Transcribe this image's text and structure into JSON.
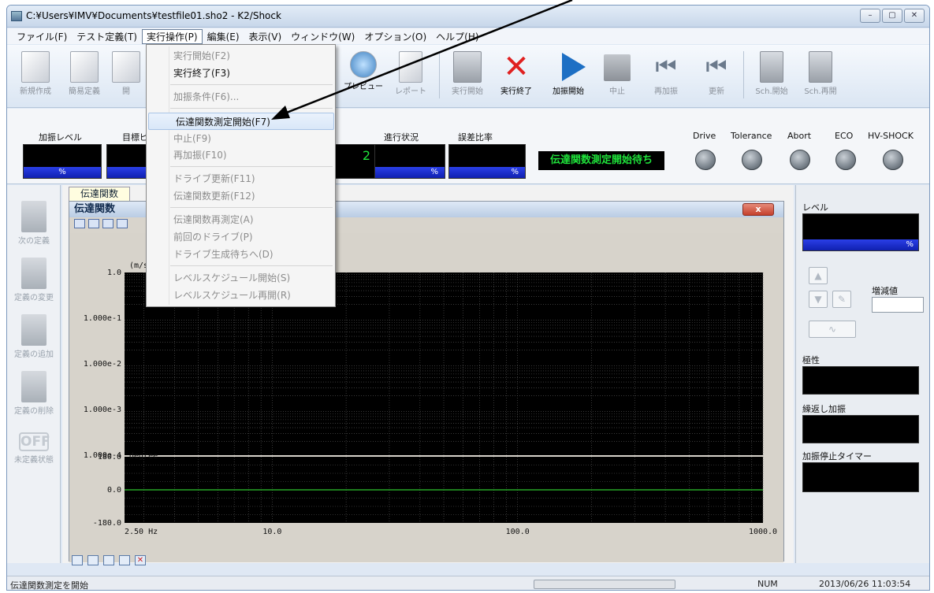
{
  "window": {
    "title": "C:¥Users¥IMV¥Documents¥testfile01.sho2 - K2/Shock",
    "min_label": "–",
    "max_label": "▢",
    "close_label": "✕"
  },
  "menu": [
    {
      "label": "ファイル(F)"
    },
    {
      "label": "テスト定義(T)"
    },
    {
      "label": "実行操作(P)"
    },
    {
      "label": "編集(E)"
    },
    {
      "label": "表示(V)"
    },
    {
      "label": "ウィンドウ(W)"
    },
    {
      "label": "オプション(O)"
    },
    {
      "label": "ヘルプ(H)"
    }
  ],
  "toolbar": [
    {
      "label": "新規作成",
      "enabled": false
    },
    {
      "label": "簡易定義",
      "enabled": false
    },
    {
      "label": "開",
      "enabled": false
    },
    {
      "label": "プレビュー",
      "enabled": true
    },
    {
      "label": "レポート",
      "enabled": false
    },
    {
      "label": "実行開始",
      "enabled": false
    },
    {
      "label": "実行終了",
      "enabled": true
    },
    {
      "label": "加振開始",
      "enabled": true
    },
    {
      "label": "中止",
      "enabled": false
    },
    {
      "label": "再加振",
      "enabled": false
    },
    {
      "label": "更新",
      "enabled": false
    },
    {
      "label": "Sch.開始",
      "enabled": false
    },
    {
      "label": "Sch.再開",
      "enabled": false
    }
  ],
  "monitor": {
    "level_label": "加振レベル",
    "level_unit": "%",
    "target_label": "目標ピ",
    "count_value": "2",
    "progress_label": "進行状況",
    "progress_unit": "%",
    "error_label": "誤差比率",
    "error_unit": "%",
    "status_message": "伝達関数測定開始待ち",
    "lamps": [
      "Drive",
      "Tolerance",
      "Abort",
      "ECO",
      "HV-SHOCK"
    ]
  },
  "left_sidebar": [
    {
      "label": "次の定義"
    },
    {
      "label": "定義の変更"
    },
    {
      "label": "定義の追加"
    },
    {
      "label": "定義の削除"
    },
    {
      "label": "未定義状態",
      "icon_text": "OFF"
    }
  ],
  "document": {
    "tab_label": "伝達関数",
    "child_title": "伝達関数",
    "child_close": "x"
  },
  "plot": {
    "magnitude_unit": "(m/s²)/",
    "y_ticks": [
      "1.0",
      "1.000e-1",
      "1.000e-2",
      "1.000e-3",
      "1.000e-4"
    ],
    "phase_unit": "degree",
    "phase_ticks": [
      "180.0",
      "0.0",
      "-180.0"
    ],
    "x_ticks": [
      "2.50 Hz",
      "10.0",
      "100.0",
      "1000.0"
    ]
  },
  "right_panel": {
    "level_label": "レベル",
    "level_unit": "%",
    "increment_label": "増減値",
    "polarity_label": "極性",
    "repeat_label": "繰返し加振",
    "timer_label": "加振停止タイマー"
  },
  "dropdown": {
    "items": [
      {
        "label": "実行開始(F2)",
        "enabled": false
      },
      {
        "label": "実行終了(F3)",
        "enabled": true
      },
      {
        "label": "加振条件(F6)...",
        "enabled": false
      },
      {
        "label": "伝達関数測定開始(F7)",
        "enabled": true,
        "highlighted": true
      },
      {
        "label": "中止(F9)",
        "enabled": false
      },
      {
        "label": "再加振(F10)",
        "enabled": false
      },
      {
        "label": "ドライブ更新(F11)",
        "enabled": false
      },
      {
        "label": "伝達関数更新(F12)",
        "enabled": false
      },
      {
        "label": "伝達関数再測定(A)",
        "enabled": false
      },
      {
        "label": "前回のドライブ(P)",
        "enabled": false
      },
      {
        "label": "ドライブ生成待ちへ(D)",
        "enabled": false
      },
      {
        "label": "レベルスケジュール開始(S)",
        "enabled": false
      },
      {
        "label": "レベルスケジュール再開(R)",
        "enabled": false
      }
    ]
  },
  "statusbar": {
    "message": "伝達関数測定を開始",
    "num": "NUM",
    "datetime": "2013/06/26  11:03:54"
  },
  "colors": {
    "trace": "#2fc52f",
    "status_text": "#1fe33b",
    "bar_blue": "#2a3fe8"
  }
}
